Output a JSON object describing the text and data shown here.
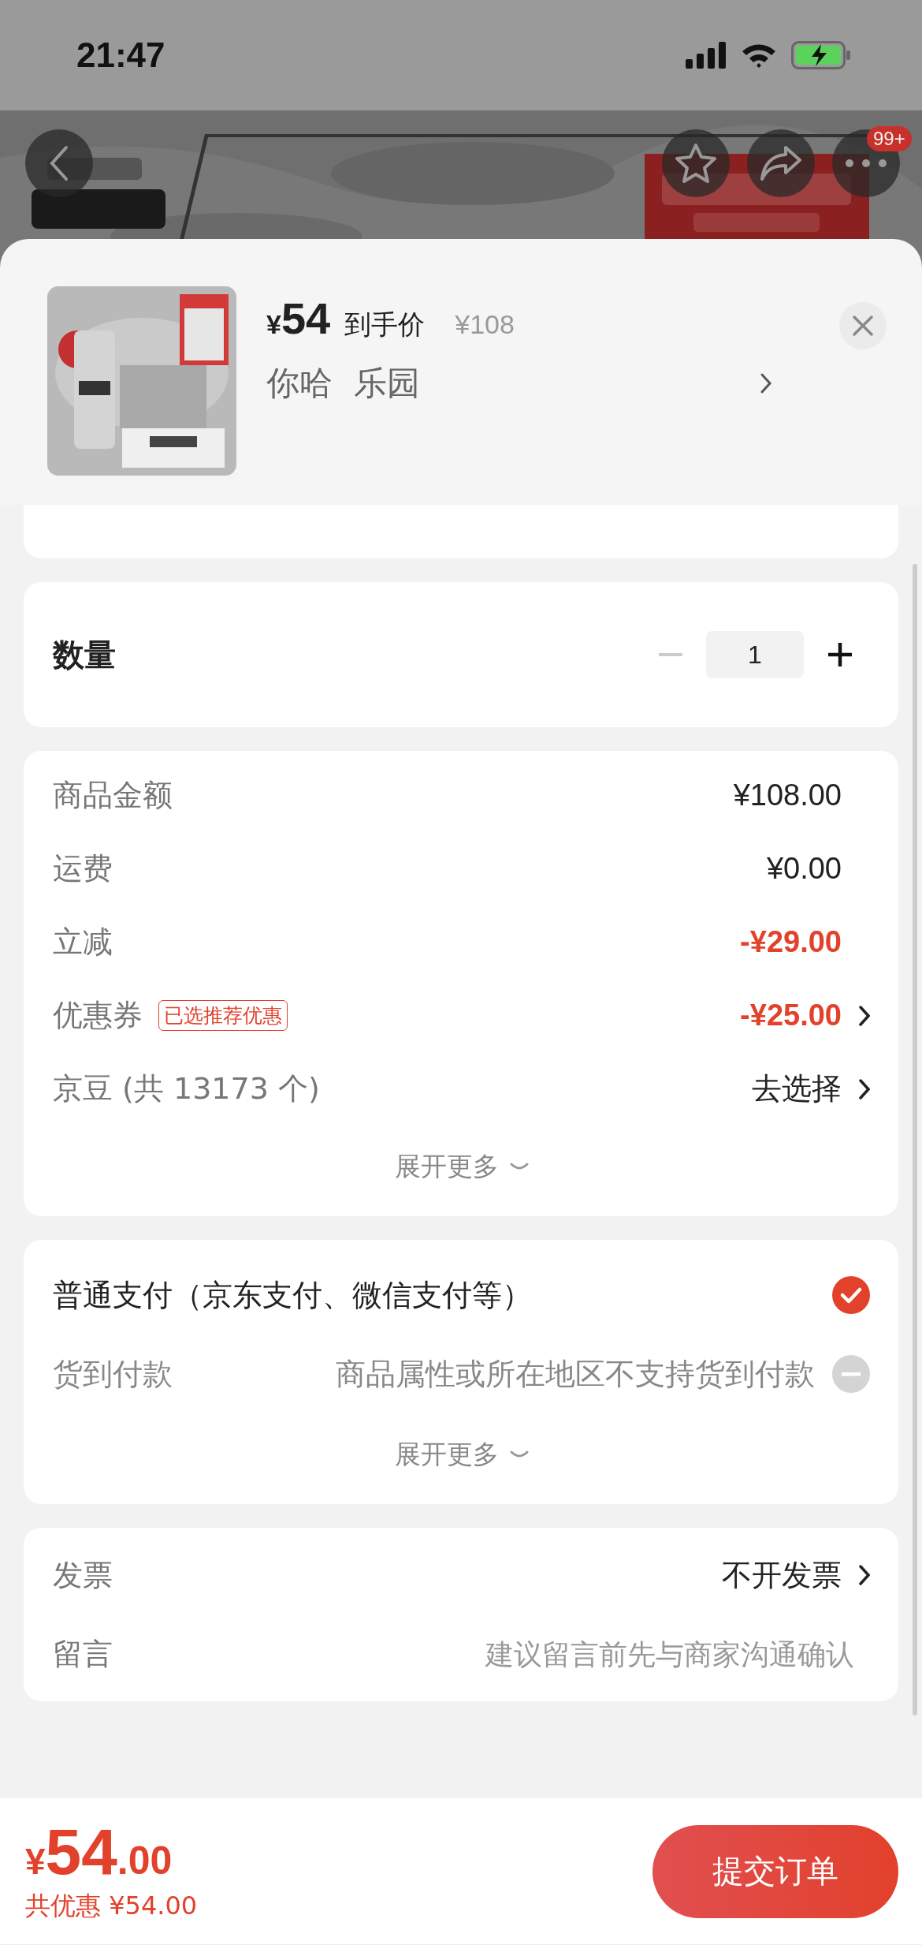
{
  "status_bar": {
    "time": "21:47"
  },
  "header": {
    "badge": "99+"
  },
  "product": {
    "currency": "¥",
    "price": "54",
    "price_label": "到手价",
    "original_price": "¥108",
    "spec": "你哈  乐园"
  },
  "quantity": {
    "label": "数量",
    "value": "1"
  },
  "price_rows": [
    {
      "label": "商品金额",
      "value": "¥108.00",
      "kind": "amount",
      "chevron": false
    },
    {
      "label": "运费",
      "value": "¥0.00",
      "kind": "amount",
      "chevron": false
    },
    {
      "label": "立减",
      "value": "-¥29.00",
      "kind": "discount",
      "chevron": false
    },
    {
      "label": "优惠券",
      "tag": "已选推荐优惠",
      "value": "-¥25.00",
      "kind": "discount",
      "chevron": true
    },
    {
      "label": "京豆 (共 13173 个)",
      "value": "去选择",
      "kind": "select",
      "chevron": true
    }
  ],
  "price_expand": "展开更多",
  "payment": {
    "options": [
      {
        "label": "普通支付（京东支付、微信支付等）",
        "selected": true,
        "disabled": false
      },
      {
        "label": "货到付款",
        "note": "商品属性或所在地区不支持货到付款",
        "selected": false,
        "disabled": true
      }
    ],
    "expand": "展开更多"
  },
  "extras": [
    {
      "kind": "value",
      "label": "发票",
      "value": "不开发票"
    },
    {
      "kind": "field",
      "label": "留言",
      "placeholder": "建议留言前先与商家沟通确认"
    }
  ],
  "footer": {
    "currency": "¥",
    "price_int": "54",
    "price_dec": ".00",
    "savings": "共优惠 ¥54.00",
    "submit": "提交订单"
  }
}
